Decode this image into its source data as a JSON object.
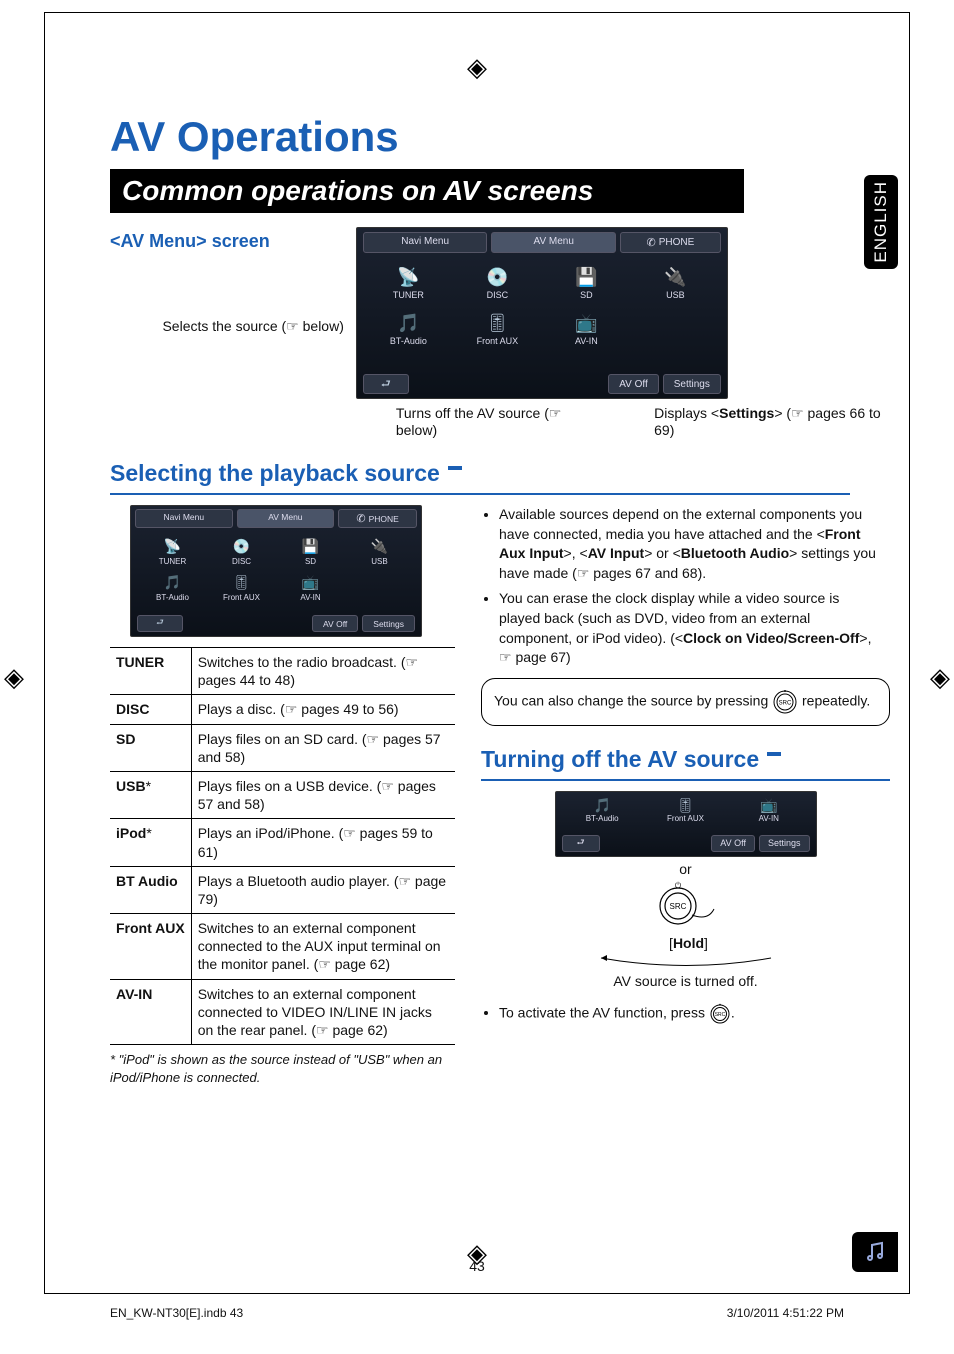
{
  "title": "AV Operations",
  "black_bar": "Common operations on AV screens",
  "av_menu_heading": "<AV Menu> screen",
  "side_tab": "ENGLISH",
  "callouts": {
    "selects_source": "Selects the source (☞ below)",
    "turns_off": "Turns off the AV source (☞ below)",
    "displays_settings_prefix": "Displays <",
    "displays_settings_bold": "Settings",
    "displays_settings_suffix": "> (☞ pages 66 to 69)"
  },
  "device_large": {
    "tabs": [
      "Navi Menu",
      "AV Menu",
      "PHONE"
    ],
    "sources": [
      {
        "icon": "📡",
        "label": "TUNER"
      },
      {
        "icon": "💿",
        "label": "DISC"
      },
      {
        "icon": "💾",
        "label": "SD"
      },
      {
        "icon": "🔌",
        "label": "USB"
      },
      {
        "icon": "🎵",
        "label": "BT-Audio"
      },
      {
        "icon": "🎚",
        "label": "Front AUX"
      },
      {
        "icon": "📺",
        "label": "AV-IN"
      },
      {
        "icon": "",
        "label": ""
      }
    ],
    "back": "⮐",
    "bottom_buttons": [
      "AV Off",
      "Settings"
    ]
  },
  "section_playback": "Selecting the playback source",
  "device_small": {
    "tabs": [
      "Navi Menu",
      "AV Menu",
      "PHONE"
    ],
    "sources": [
      {
        "icon": "📡",
        "label": "TUNER"
      },
      {
        "icon": "💿",
        "label": "DISC"
      },
      {
        "icon": "💾",
        "label": "SD"
      },
      {
        "icon": "🔌",
        "label": "USB"
      },
      {
        "icon": "🎵",
        "label": "BT-Audio"
      },
      {
        "icon": "🎚",
        "label": "Front AUX"
      },
      {
        "icon": "📺",
        "label": "AV-IN"
      },
      {
        "icon": "",
        "label": ""
      }
    ],
    "back": "⮐",
    "bottom_buttons": [
      "AV Off",
      "Settings"
    ]
  },
  "src_table": [
    {
      "name": "TUNER",
      "desc": "Switches to the radio broadcast. (☞ pages 44 to 48)"
    },
    {
      "name": "DISC",
      "desc": "Plays a disc. (☞ pages 49 to 56)"
    },
    {
      "name": "SD",
      "desc": "Plays files on an SD card. (☞ pages 57 and 58)"
    },
    {
      "name": "USB *",
      "desc": "Plays files on a USB device. (☞ pages 57 and 58)"
    },
    {
      "name": "iPod *",
      "desc": "Plays an iPod/iPhone. (☞ pages 59 to 61)"
    },
    {
      "name": "BT Audio",
      "desc": "Plays a Bluetooth audio player. (☞ page 79)"
    },
    {
      "name": "Front AUX",
      "desc": "Switches to an external component connected to the AUX input terminal on the monitor panel. (☞ page 62)"
    },
    {
      "name": "AV-IN",
      "desc": "Switches to an external component connected to VIDEO IN/LINE IN jacks on the rear panel. (☞ page 62)"
    }
  ],
  "footnote": "*  \"iPod\" is shown as the source instead of \"USB\" when an iPod/iPhone is connected.",
  "right_bullets": {
    "b1_pre": "Available sources depend on the external components you have connected, media you have attached and the <",
    "b1_bold1": "Front Aux Input",
    "b1_mid1": ">, <",
    "b1_bold2": "AV Input",
    "b1_mid2": "> or <",
    "b1_bold3": "Bluetooth Audio",
    "b1_post": "> settings you have made (☞ pages 67 and 68).",
    "b2_pre": "You can erase the clock display while a video source is played back (such as DVD, video from an external component, or iPod video). (<",
    "b2_bold": "Clock on Video/Screen-Off",
    "b2_post": ">, ☞ page 67)"
  },
  "round_box": {
    "text_pre": "You can also change the source by pressing ",
    "text_post": " repeatedly."
  },
  "section_turnoff": "Turning off the AV source",
  "av_off_strip": {
    "row": [
      {
        "icon": "🎵",
        "label": "BT-Audio"
      },
      {
        "icon": "🎚",
        "label": "Front AUX"
      },
      {
        "icon": "📺",
        "label": "AV-IN"
      }
    ],
    "back": "⮐",
    "bottom_buttons": [
      "AV Off",
      "Settings"
    ]
  },
  "or_label": "or",
  "hold_label_pre": "[",
  "hold_label_bold": "Hold",
  "hold_label_post": "]",
  "av_off_caption": "AV source is turned off.",
  "activate_text": "To activate the AV function, press ",
  "activate_post": ".",
  "page_number": "43",
  "footer_left": "EN_KW-NT30[E].indb   43",
  "footer_right": "3/10/2011   4:51:22 PM"
}
